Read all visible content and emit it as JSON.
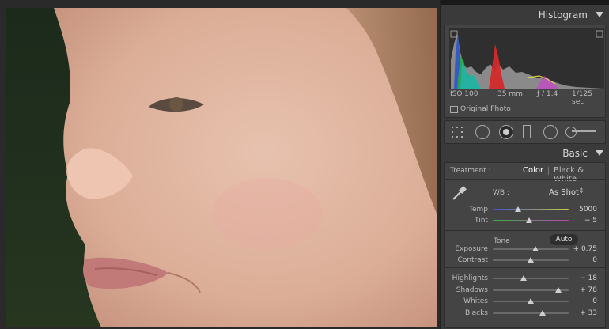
{
  "histogram": {
    "title": "Histogram",
    "iso": "ISO 100",
    "focal": "35 mm",
    "aperture": "ƒ / 1,4",
    "shutter": "1/125 sec",
    "original_photo_label": "Original Photo"
  },
  "basic": {
    "title": "Basic",
    "treatment_label": "Treatment :",
    "treatment_color": "Color",
    "treatment_bw": "Black & White",
    "wb_label": "WB :",
    "wb_value": "As Shot",
    "temp_label": "Temp",
    "temp_value": "5000",
    "tint_label": "Tint",
    "tint_value": "− 5",
    "tone_label": "Tone",
    "auto_label": "Auto",
    "sliders": [
      {
        "label": "Exposure",
        "value": "+ 0,75",
        "level": 0.56
      },
      {
        "label": "Contrast",
        "value": "0",
        "level": 0.5
      },
      {
        "label": "Highlights",
        "value": "− 18",
        "level": 0.41
      },
      {
        "label": "Shadows",
        "value": "+ 78",
        "level": 0.86
      },
      {
        "label": "Whites",
        "value": "0",
        "level": 0.5
      },
      {
        "label": "Blacks",
        "value": "+ 33",
        "level": 0.66
      }
    ],
    "temp_level": 0.33,
    "tint_level": 0.48
  }
}
